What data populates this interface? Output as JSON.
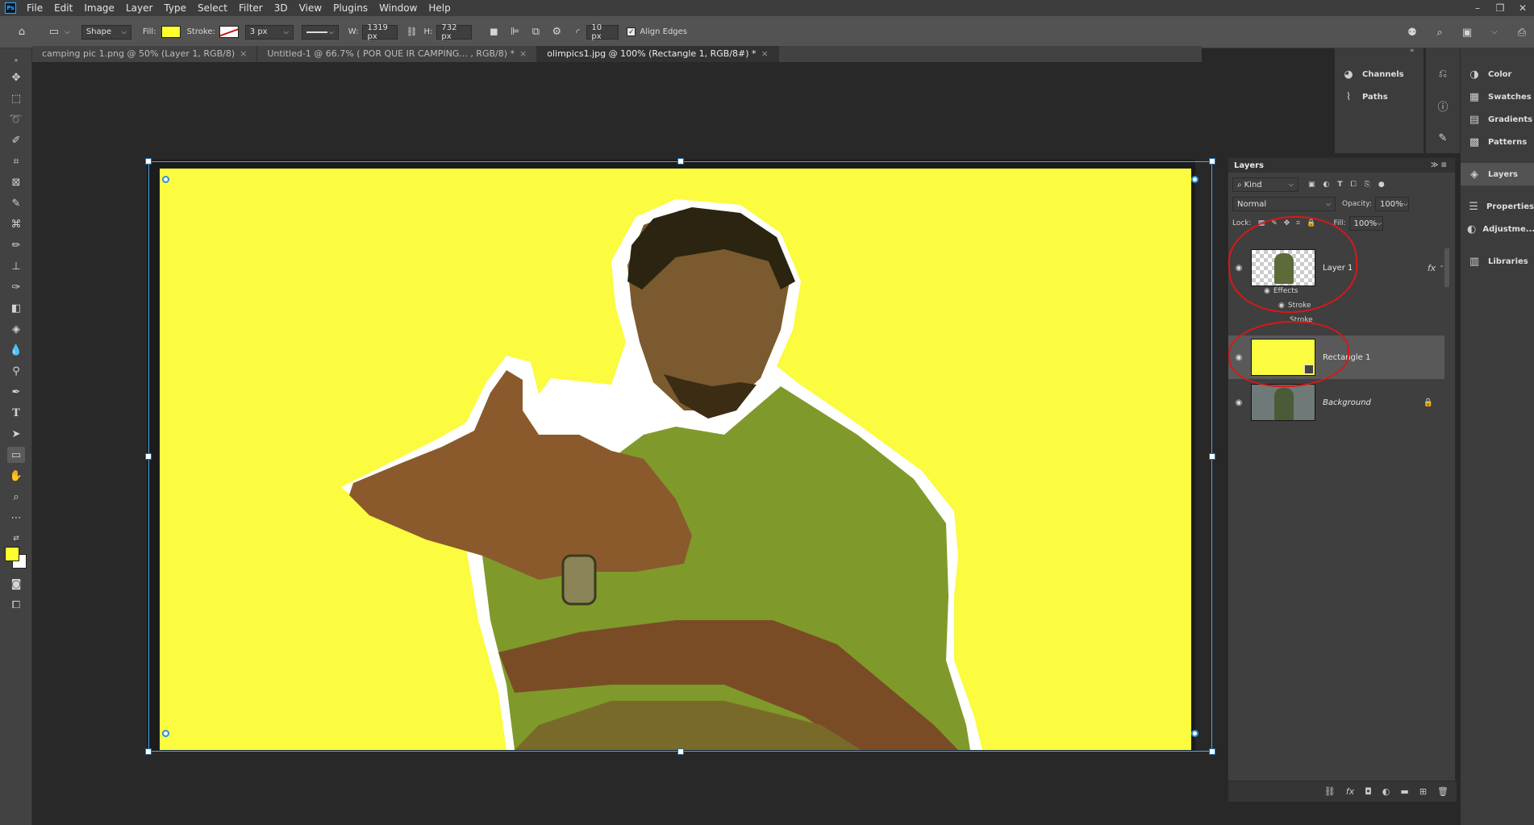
{
  "app": {
    "logo": "Ps"
  },
  "menu": [
    "File",
    "Edit",
    "Image",
    "Layer",
    "Type",
    "Select",
    "Filter",
    "3D",
    "View",
    "Plugins",
    "Window",
    "Help"
  ],
  "window_controls": [
    "–",
    "❐",
    "✕"
  ],
  "options": {
    "mode": "Shape",
    "fill_label": "Fill:",
    "stroke_label": "Stroke:",
    "stroke_width": "3 px",
    "w_label": "W:",
    "w_value": "1319 px",
    "h_label": "H:",
    "h_value": "732 px",
    "radius": "10 px",
    "align_edges": "Align Edges",
    "fill_color": "#ffff2e"
  },
  "tabs": [
    {
      "label": "camping pic 1.png @ 50% (Layer 1, RGB/8)"
    },
    {
      "label": "Untitled-1 @ 66.7% ( POR QUE IR CAMPING... , RGB/8) *"
    },
    {
      "label": "olimpics1.jpg @ 100% (Rectangle 1, RGB/8#) *"
    }
  ],
  "dock_top": [
    {
      "label": "Channels",
      "icon": "channels-icon"
    },
    {
      "label": "Paths",
      "icon": "paths-icon"
    }
  ],
  "dock_right": [
    {
      "label": "Color",
      "icon": "color-icon"
    },
    {
      "label": "Swatches",
      "icon": "swatches-icon"
    },
    {
      "label": "Gradients",
      "icon": "gradients-icon"
    },
    {
      "label": "Patterns",
      "icon": "patterns-icon"
    },
    {
      "label": "Layers",
      "icon": "layers-icon"
    },
    {
      "label": "Properties",
      "icon": "properties-icon"
    },
    {
      "label": "Adjustme...",
      "icon": "adjustments-icon"
    },
    {
      "label": "Libraries",
      "icon": "libraries-icon"
    }
  ],
  "layers_panel": {
    "title": "Layers",
    "kind": "Kind",
    "blend": "Normal",
    "opacity_label": "Opacity:",
    "opacity": "100%",
    "lock_label": "Lock:",
    "fill_label": "Fill:",
    "fill": "100%",
    "fx": "fx",
    "layers": [
      {
        "name": "Layer 1",
        "effects": "Effects",
        "stroke1": "Stroke",
        "stroke2": "Stroke"
      },
      {
        "name": "Rectangle 1"
      },
      {
        "name": "Background"
      }
    ]
  },
  "colors": {
    "canvas_yellow": "#fbfb3f",
    "selection": "#4aa7e8",
    "annotation": "#d81818"
  }
}
